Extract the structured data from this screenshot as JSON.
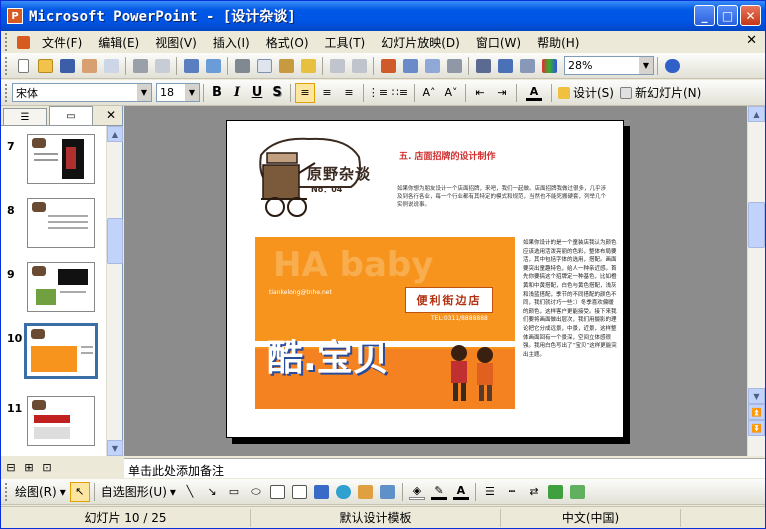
{
  "window": {
    "title": "Microsoft PowerPoint - [设计杂谈]",
    "app_icon": "P"
  },
  "titlebar_buttons": {
    "minimize": "_",
    "maximize": "□",
    "close": "✕"
  },
  "menu": [
    "文件(F)",
    "编辑(E)",
    "视图(V)",
    "插入(I)",
    "格式(O)",
    "工具(T)",
    "幻灯片放映(D)",
    "窗口(W)",
    "帮助(H)"
  ],
  "menu_close": "✕",
  "standard_toolbar": {
    "zoom": "28%"
  },
  "formatting_toolbar": {
    "font": "宋体",
    "size": "18",
    "bold": "B",
    "italic": "I",
    "underline": "U",
    "shadow": "S",
    "design_label": "设计(S)",
    "new_slide_label": "新幻灯片(N)"
  },
  "drawing_toolbar": {
    "draw_label": "绘图(R)",
    "autoshape_label": "自选图形(U)"
  },
  "slides_pane": {
    "thumbnails": [
      {
        "num": "7"
      },
      {
        "num": "8"
      },
      {
        "num": "9"
      },
      {
        "num": "10",
        "selected": true
      },
      {
        "num": "11"
      }
    ]
  },
  "slide": {
    "logo_text": "原野杂谈",
    "logo_sub": "No：04",
    "heading": "五. 店面招牌的设计制作",
    "intro": "如果你想为朋友设计一个店面招牌，来吧，我们一起做。店面招牌我做过很多，几乎涉及到各行各业，每一个行业都有其特定的模式和规范，当然也不能死搬硬套，列举几个实例说说事。",
    "banner_url": "tiankelong@tnhe.net",
    "banner_store": "便利街边店",
    "banner_tel": "TEL:0311/8888888",
    "banner_bg": "HA baby",
    "banner_main": "酷.宝贝",
    "side_text": "如果你设计的是一个童装店我认为颜色应该选用活泼亮丽的色彩，整体布局要活，其中包括字体的选用，搭配。画面要突出童趣特色，给人一种亲近感。首先你要搞这个招牌定一种基色，比如橙黄和中黄搭配，白色与黄色搭配，浅灰和浅蓝搭配，季节的不同搭配的颜色不同，我们就讨巧一些：）冬季喜欢偏暖的颜色，这样客户更能接受。接下来我们要将画面做出层次，我们用摄影的理论把它分成远景，中景，近景，这样整体画面回有一个景深，空间立体感很强。我用白色写出了“宝贝”这样更能突出主题。"
  },
  "notes_placeholder": "单击此处添加备注",
  "status": {
    "slide": "幻灯片 10 / 25",
    "template": "默认设计模板",
    "language": "中文(中国)"
  },
  "colors": {
    "title_blue": "#0054e3",
    "banner_orange": "#f7941d",
    "heading_red": "#d03030",
    "selection": "#3a6ea5"
  }
}
